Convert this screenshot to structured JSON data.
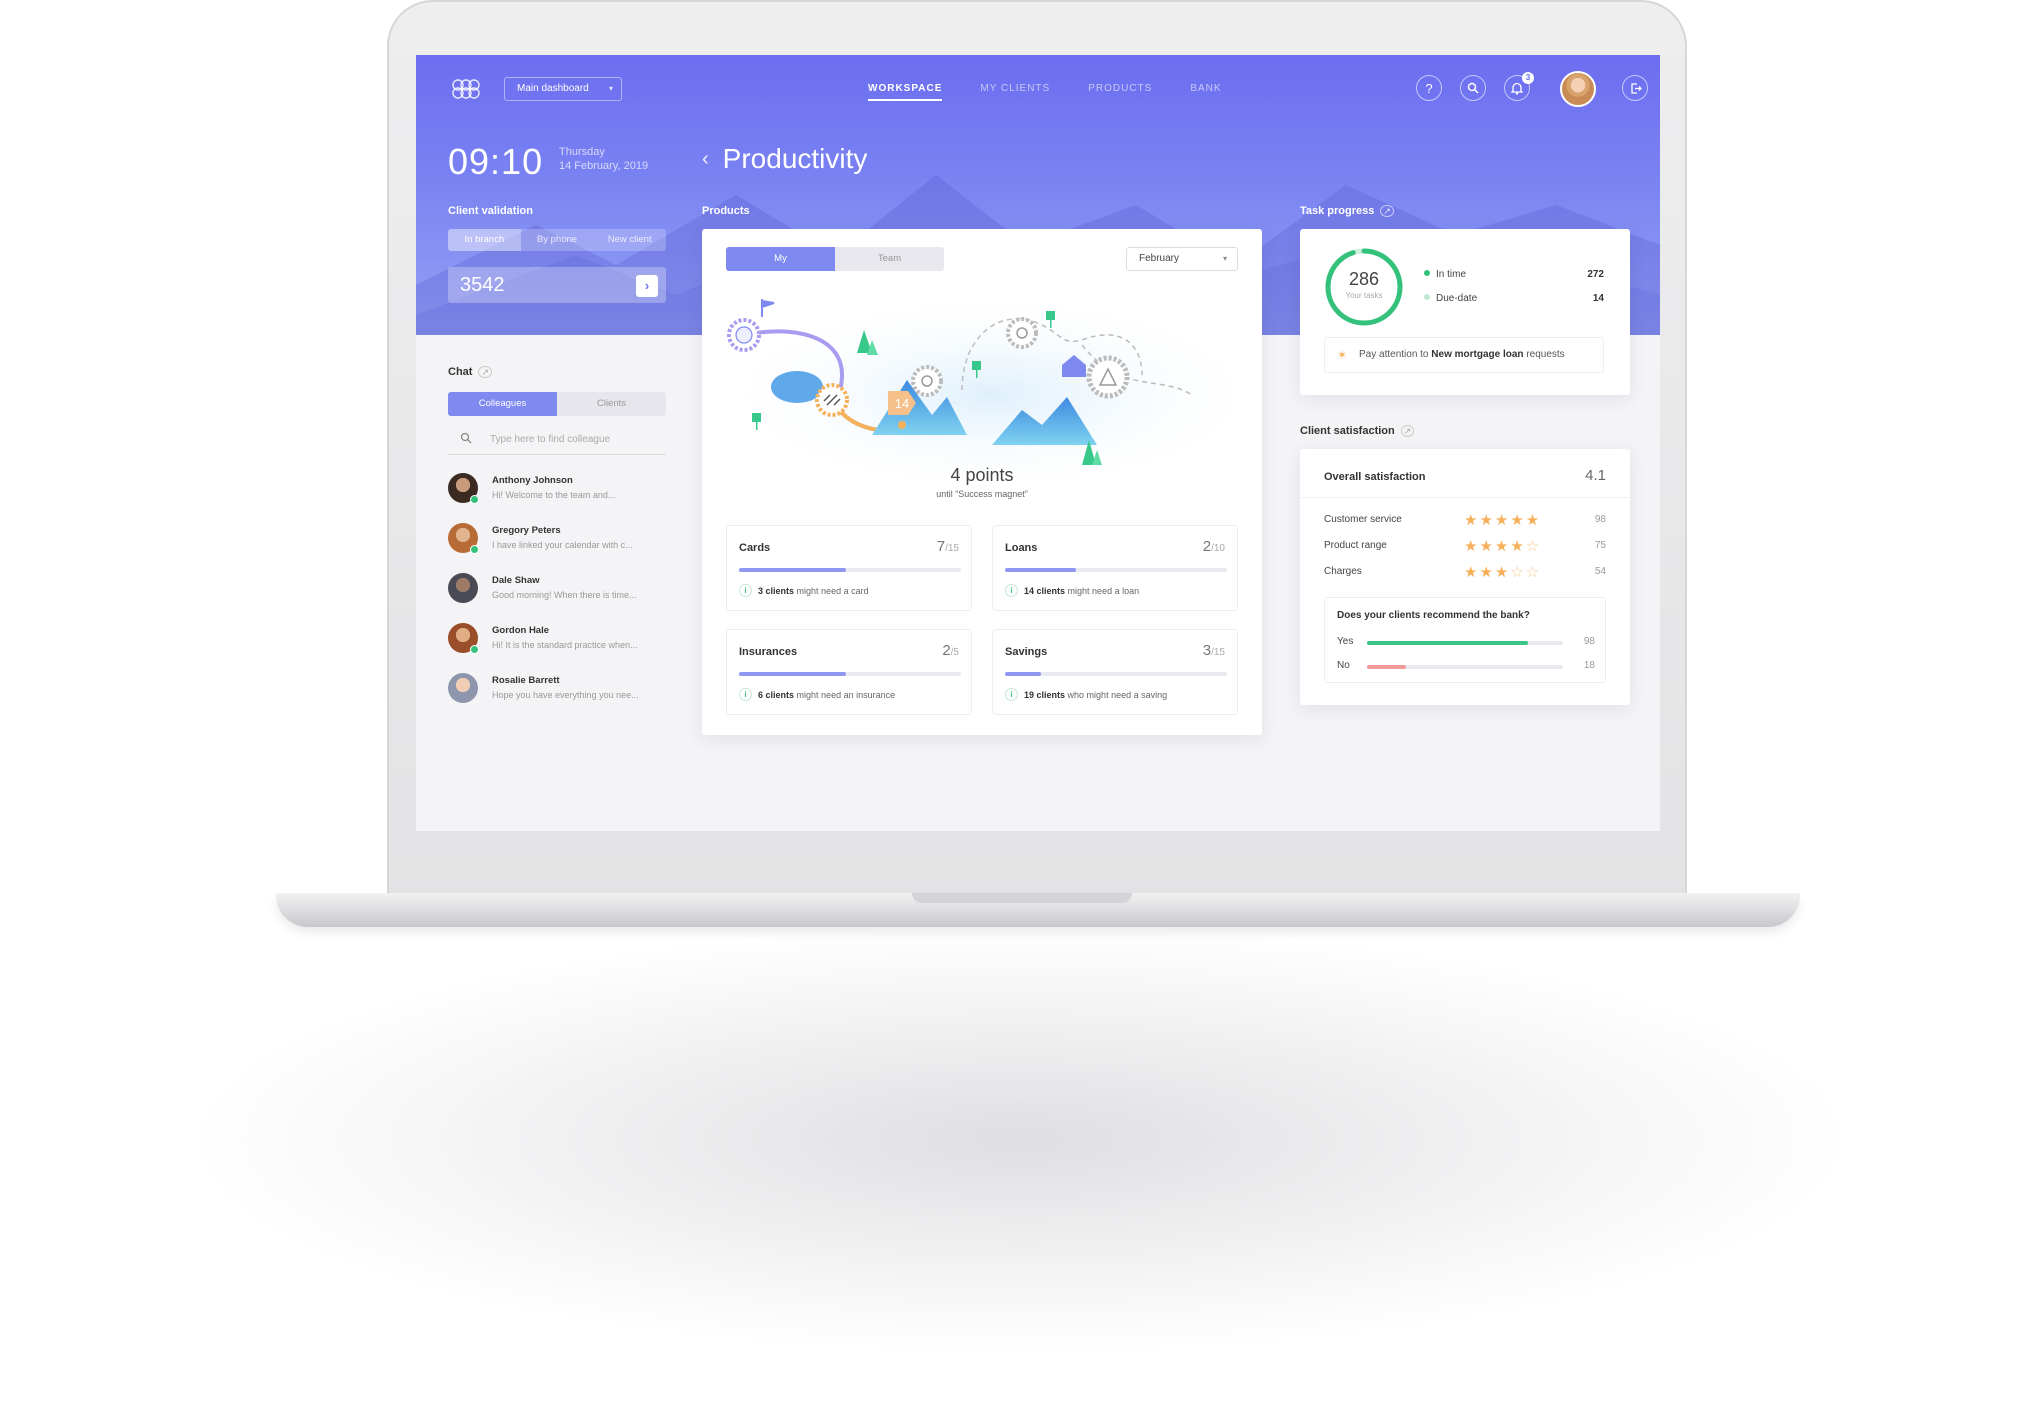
{
  "topbar": {
    "dashboard_select": "Main dashboard",
    "nav": [
      "WORKSPACE",
      "MY CLIENTS",
      "PRODUCTS",
      "BANK"
    ],
    "notification_count": "3"
  },
  "hero": {
    "time": "09:10",
    "day": "Thursday",
    "date": "14 February, 2019",
    "page_title": "Productivity"
  },
  "client_validation": {
    "label": "Client validation",
    "tabs": [
      "In branch",
      "By phone",
      "New client"
    ],
    "value": "3542"
  },
  "chat": {
    "label": "Chat",
    "tabs": [
      "Colleagues",
      "Clients"
    ],
    "search_placeholder": "Type here to find colleague",
    "items": [
      {
        "name": "Anthony Johnson",
        "message": "Hi! Welcome to the team and..."
      },
      {
        "name": "Gregory Peters",
        "message": "I have linked your calendar with c..."
      },
      {
        "name": "Dale Shaw",
        "message": "Good morning! When there is time..."
      },
      {
        "name": "Gordon Hale",
        "message": "Hi! It is the standard practice when..."
      },
      {
        "name": "Rosalie Barrett",
        "message": "Hope you have everything you nee..."
      }
    ]
  },
  "products": {
    "label": "Products",
    "tabs": [
      "My",
      "Team"
    ],
    "month": "February",
    "badge": "14",
    "points": "4 points",
    "points_sub": "until “Success magnet”",
    "metrics": [
      {
        "name": "Cards",
        "count": "7",
        "total": "/15",
        "progress": 0.48,
        "count_bold": "3 clients",
        "info": "might need a card"
      },
      {
        "name": "Loans",
        "count": "2",
        "total": "/10",
        "progress": 0.32,
        "count_bold": "14 clients",
        "info": "might need a loan"
      },
      {
        "name": "Insurances",
        "count": "2",
        "total": "/5",
        "progress": 0.48,
        "count_bold": "6 clients",
        "info": "might need an insurance"
      },
      {
        "name": "Savings",
        "count": "3",
        "total": "/15",
        "progress": 0.16,
        "count_bold": "19 clients",
        "info": "who might need a saving"
      }
    ]
  },
  "task_progress": {
    "label": "Task progress",
    "total": "286",
    "total_sub": "Your tasks",
    "legend": [
      {
        "label": "In time",
        "value": "272",
        "color": "#34c17b"
      },
      {
        "label": "Due-date",
        "value": "14",
        "color": "#bfe9d4"
      }
    ],
    "ring_fraction": 0.95,
    "attention_pre": "Pay attention to",
    "attention_bold": "New mortgage loan",
    "attention_post": "requests"
  },
  "client_satisfaction": {
    "label": "Client satisfaction",
    "overall_label": "Overall satisfaction",
    "overall_value": "4.1",
    "ratings": [
      {
        "name": "Customer service",
        "stars": 5,
        "value": "98"
      },
      {
        "name": "Product range",
        "stars": 4,
        "value": "75"
      },
      {
        "name": "Charges",
        "stars": 3,
        "value": "54"
      }
    ],
    "recommend_question": "Does your clients recommend the bank?",
    "recommend": [
      {
        "label": "Yes",
        "value": "98",
        "fraction": 0.82,
        "color": "#3cc58a"
      },
      {
        "label": "No",
        "value": "18",
        "fraction": 0.2,
        "color": "#f29a9a"
      }
    ]
  }
}
